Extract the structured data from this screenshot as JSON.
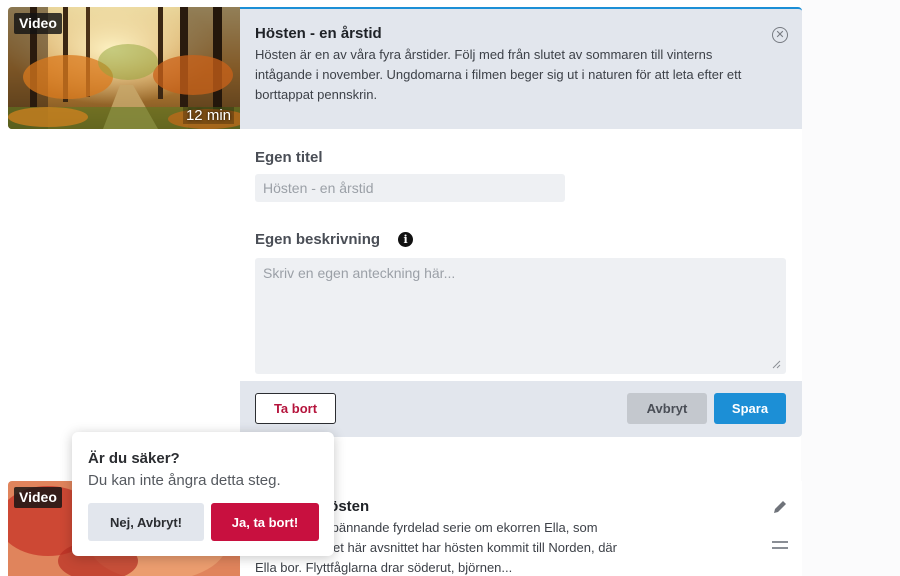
{
  "colors": {
    "accent": "#1c8fd6",
    "danger": "#c8103f",
    "panel": "#e2e6ed"
  },
  "items": [
    {
      "badge": "Video",
      "duration": "12 min",
      "title": "Hösten - en årstid",
      "description": "Hösten är en av våra fyra årstider. Följ med från slutet av sommaren till vinterns intågande i november. Ungdomarna i filmen beger sig ut i naturen för att leta efter ett borttappat pennskrin."
    },
    {
      "badge": "Video",
      "title": "tiderna - Hösten",
      "description_lines": [
        "derna är en spännande fyrdelad serie om ekorren Ella, som",
        "n närmiljö. I det här avsnittet har hösten kommit till Norden, där",
        "Ella bor. Flyttfåglarna drar söderut, björnen..."
      ]
    }
  ],
  "edit": {
    "title_label": "Egen titel",
    "title_placeholder": "Hösten - en årstid",
    "desc_label": "Egen beskrivning",
    "desc_placeholder": "Skriv en egen anteckning här...",
    "delete_label": "Ta bort",
    "cancel_label": "Avbryt",
    "save_label": "Spara"
  },
  "confirm": {
    "title": "Är du säker?",
    "subtitle": "Du kan inte ångra detta steg.",
    "no_label": "Nej, Avbryt!",
    "yes_label": "Ja, ta bort!"
  },
  "icons": {
    "close": "close-circle-icon",
    "info": "info-icon",
    "edit": "pencil-icon",
    "drag": "drag-handle-icon"
  }
}
